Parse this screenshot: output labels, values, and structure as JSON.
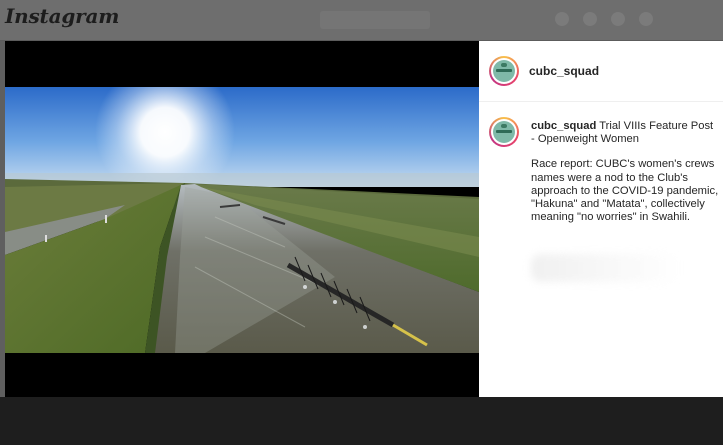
{
  "app": {
    "logo_text": "Instagram"
  },
  "post": {
    "username": "cubc_squad",
    "caption_title": "Trial VIIIs Feature Post - Openweight Women",
    "caption_body": "Race report: CUBC's women's crews names were a nod to the Club's approach to the COVID-19 pandemic, \"Hakuna\" and \"Matata\", collectively meaning \"no worries\" in Swahili."
  },
  "colors": {
    "modal_overlay": "#5f5f5f",
    "header_dimmed": "#6e6e6e",
    "panel_bg": "#ffffff",
    "text_primary": "#262626",
    "avatar_ring": "#e9446a"
  },
  "icons": {
    "profile_avatar": "cubc-logo-avatar"
  }
}
